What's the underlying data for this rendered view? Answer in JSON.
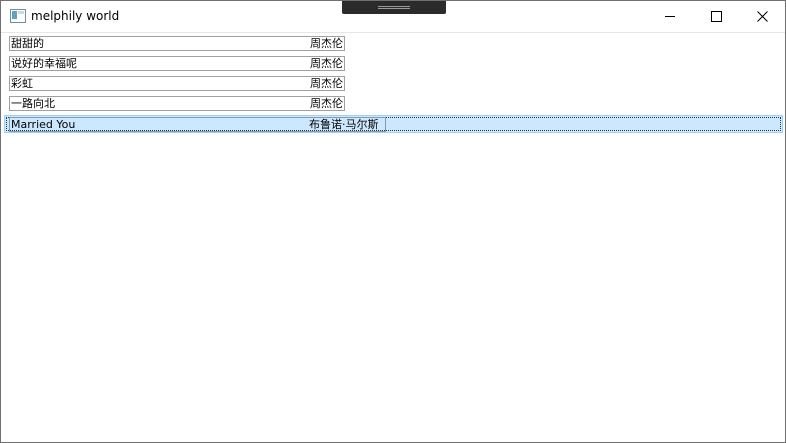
{
  "window": {
    "title": "melphily world"
  },
  "icons": {
    "app": "app-window-icon",
    "minimize": "minimize-icon",
    "maximize": "maximize-icon",
    "close": "close-icon"
  },
  "songs": [
    {
      "name": "甜甜的",
      "artist": "周杰伦"
    },
    {
      "name": "说好的幸福呢",
      "artist": "周杰伦"
    },
    {
      "name": "彩虹",
      "artist": "周杰伦"
    },
    {
      "name": "一路向北",
      "artist": "周杰伦"
    },
    {
      "name": "Married You",
      "artist": "布鲁诺·马尔斯"
    }
  ],
  "colors": {
    "selection_background": "#cce8ff",
    "selection_border": "#99d1ff"
  }
}
